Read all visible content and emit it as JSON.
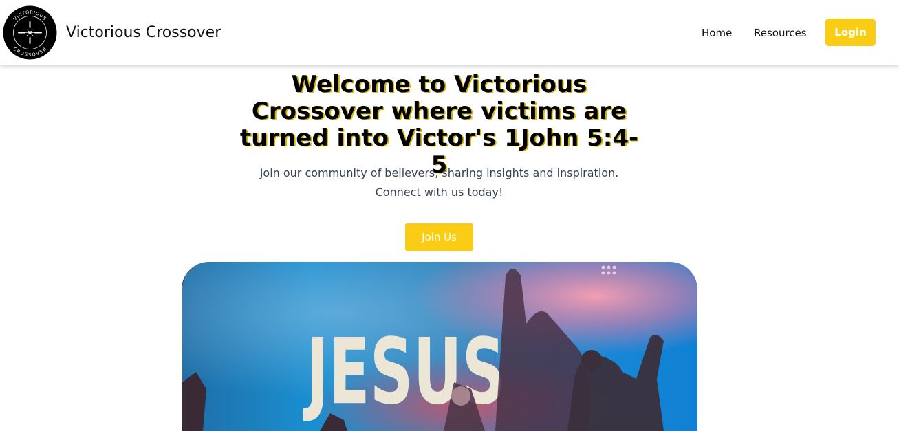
{
  "header": {
    "logo": {
      "icon": "cross-logo-icon",
      "top_text": "VICTORIOUS",
      "bottom_text": "CROSSOVER"
    },
    "site_name": "Victorious Crossover",
    "nav": [
      {
        "label": "Home"
      },
      {
        "label": "Resources"
      }
    ],
    "login_label": "Login"
  },
  "hero": {
    "title": "Welcome to Victorious Crossover where victims are turned into Victor's 1John 5:4-5",
    "subtitle_line1": "Join our community of believers, sharing insights and inspiration.",
    "subtitle_line2": "Connect with us today!",
    "cta_label": "Join Us",
    "image_text": "JESUS"
  },
  "colors": {
    "accent": "#facc15",
    "text_dark": "#111111",
    "text_muted": "#374151"
  }
}
